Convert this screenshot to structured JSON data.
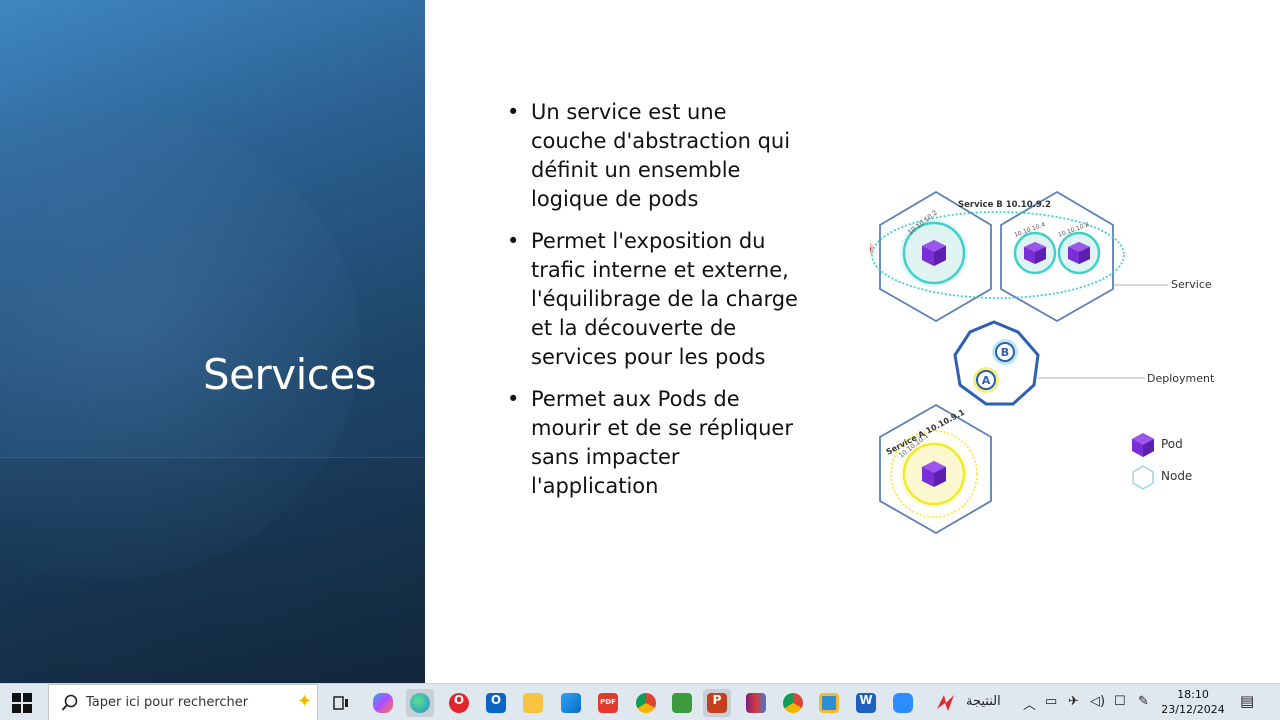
{
  "slide": {
    "title": "Services",
    "bullets": [
      "Un service est une couche d'abstraction qui définit un ensemble logique de pods",
      "Permet l'exposition du trafic interne et externe, l'équilibrage de la charge et la découverte de services pour les pods",
      "Permet aux Pods de mourir et de se répliquer sans impacter l'application"
    ],
    "bullet_glyph": "•"
  },
  "diagram": {
    "service_b_label": "Service B 10.10.9.2",
    "pod_ip_1": "10.10.10.2",
    "pod_ip_2": "10.10.10.4",
    "pod_ip_3": "10.10.10.8",
    "service_callout": "Service",
    "deployment_callout": "Deployment",
    "deploy_b": "B",
    "deploy_a": "A",
    "service_a_label": "Service A  10.10.9.1",
    "pod_ip_a": "10.10.10.1",
    "legend": {
      "pod": "Pod",
      "node": "Node"
    },
    "colors": {
      "pod": "#7a2fd6",
      "node_stroke": "#5b7fb5",
      "service_b": "#3fd1c9",
      "service_a": "#f0ea28",
      "deployment": "#2d5fb3"
    }
  },
  "taskbar": {
    "search_placeholder": "Taper ici pour rechercher",
    "tray_text": "النتيجة",
    "time": "18:10",
    "date": "23/12/2024",
    "apps": [
      {
        "name": "task-view-icon",
        "label": ""
      },
      {
        "name": "copilot-icon",
        "label": ""
      },
      {
        "name": "edge-icon",
        "label": ""
      },
      {
        "name": "opera-icon",
        "label": "O"
      },
      {
        "name": "outlook-icon",
        "label": "O"
      },
      {
        "name": "file-explorer-icon",
        "label": ""
      },
      {
        "name": "store-icon",
        "label": ""
      },
      {
        "name": "pdf-icon",
        "label": "PDF"
      },
      {
        "name": "chrome-icon",
        "label": ""
      },
      {
        "name": "notepad-icon",
        "label": ""
      },
      {
        "name": "powerpoint-icon",
        "label": "P"
      },
      {
        "name": "winrar-icon",
        "label": ""
      },
      {
        "name": "chrome-profile-icon",
        "label": ""
      },
      {
        "name": "sandbox-icon",
        "label": ""
      },
      {
        "name": "word-icon",
        "label": "W"
      },
      {
        "name": "zoom-icon",
        "label": ""
      },
      {
        "name": "app-logo-icon",
        "label": ""
      }
    ]
  }
}
